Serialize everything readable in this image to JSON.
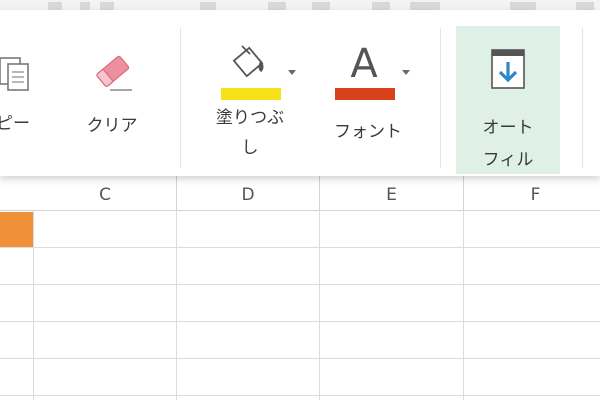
{
  "ribbon": {
    "copy_label_fragment": "ピー",
    "clear_label": "クリア",
    "fill_label_line1": "塗りつぶ",
    "fill_label_line2": "し",
    "font_label": "フォント",
    "font_icon_glyph": "A",
    "autofill_label_line1": "オート",
    "autofill_label_line2": "フィル",
    "fill_color": "#f7e11b",
    "font_color": "#d9401c",
    "autofill_highlight": "#dff0e6"
  },
  "grid": {
    "columns": [
      "C",
      "D",
      "E",
      "F"
    ],
    "selected_cell_color": "#f0913a"
  }
}
